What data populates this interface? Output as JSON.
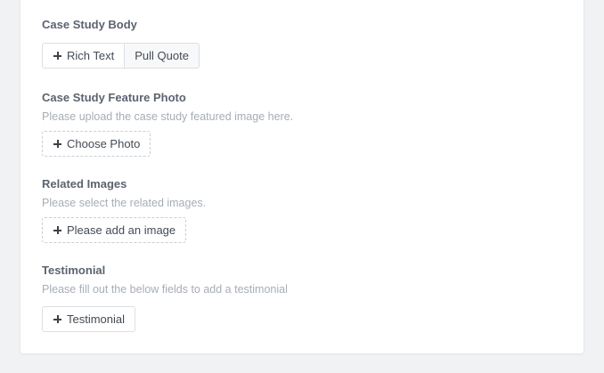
{
  "body_section": {
    "title": "Case Study Body",
    "buttons": {
      "rich_text": "Rich Text",
      "pull_quote": "Pull Quote"
    }
  },
  "feature_photo_section": {
    "title": "Case Study Feature Photo",
    "description": "Please upload the case study featured image here.",
    "button_label": "Choose Photo"
  },
  "related_images_section": {
    "title": "Related Images",
    "description": "Please select the related images.",
    "button_label": "Please add an image"
  },
  "testimonial_section": {
    "title": "Testimonial",
    "description": "Please fill out the below fields to add a testimonial",
    "button_label": "Testimonial"
  },
  "icons": {
    "add": "plus-icon"
  }
}
